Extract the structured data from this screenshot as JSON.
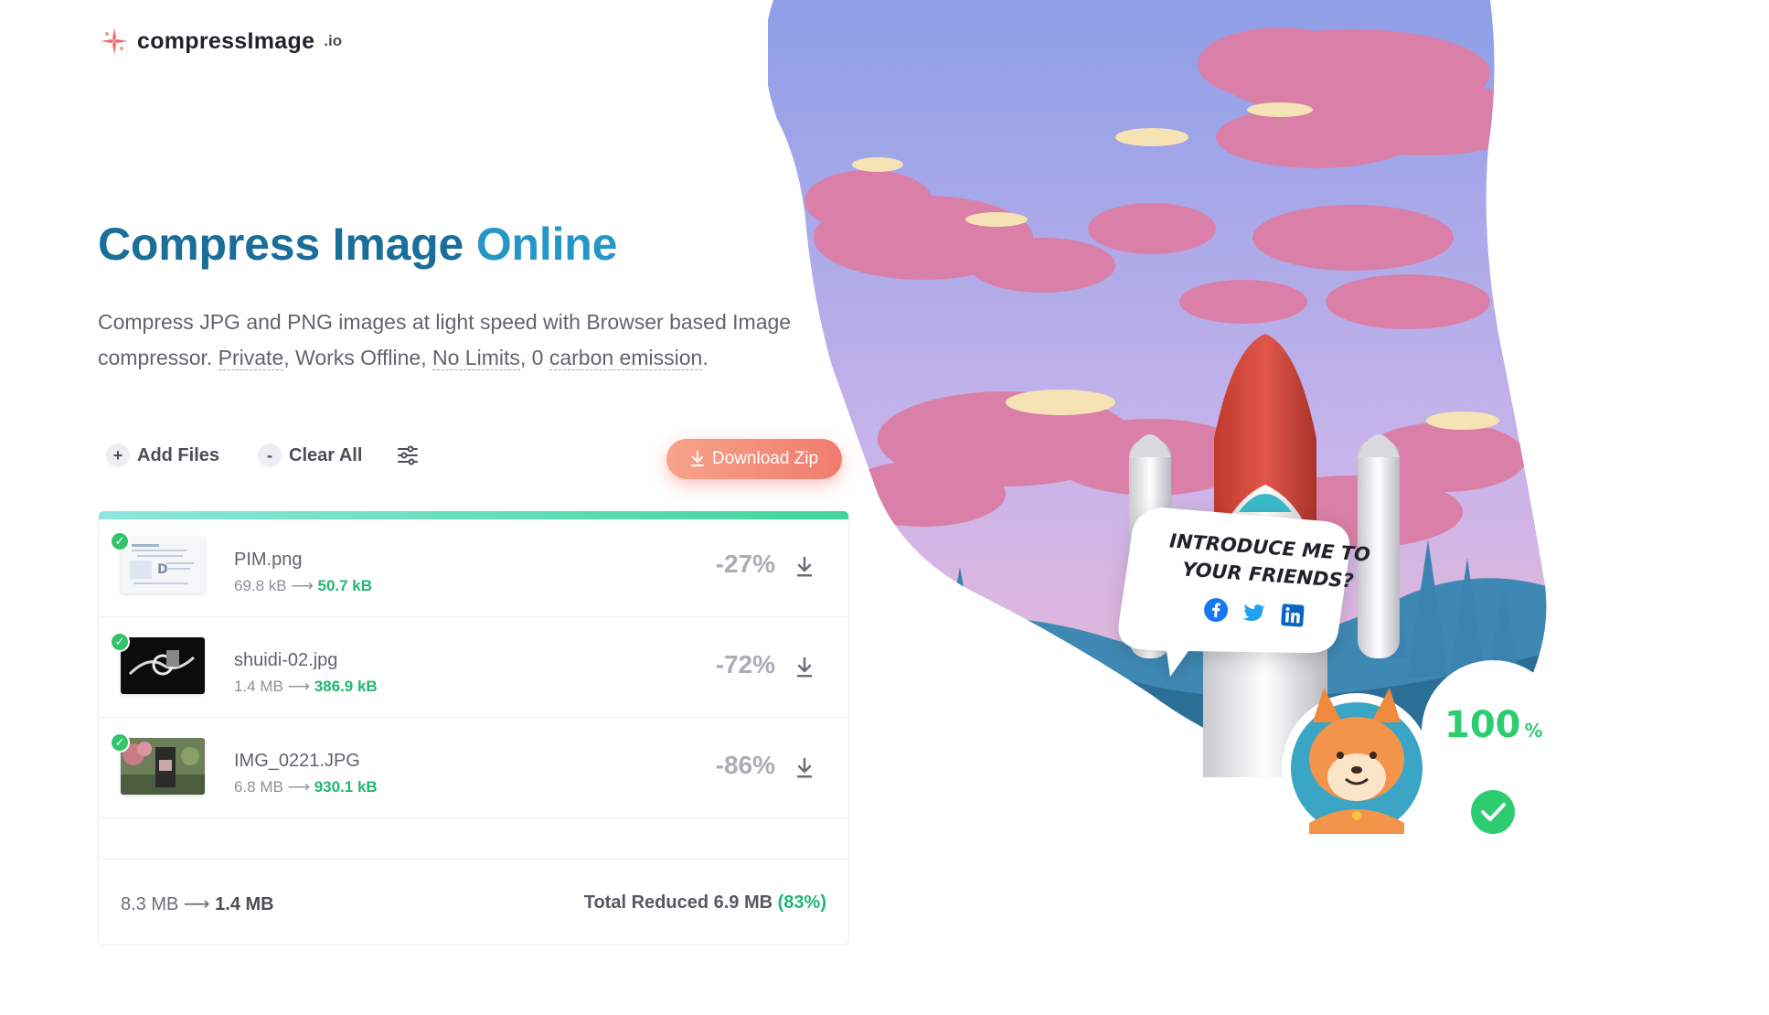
{
  "brand": {
    "name": "compressImage",
    "tld": ".io"
  },
  "hero": {
    "title_part1": "Compress Image",
    "title_part2": "Online",
    "desc_line1": "Compress JPG and PNG images at light speed with Browser based Image",
    "desc_line2_prefix": "compressor. ",
    "link_private": "Private",
    "sep1": ", Works Offline, ",
    "link_nolimits": "No Limits",
    "sep2": ", 0 ",
    "link_carbon": "carbon emission",
    "end": "."
  },
  "toolbar": {
    "add_files_symbol": "+",
    "add_files": "Add Files",
    "clear_all_symbol": "-",
    "clear_all": "Clear All",
    "download_zip": "Download Zip"
  },
  "progress": 1.0,
  "files": [
    {
      "name": "PIM.png",
      "original": "69.8 kB",
      "compressed": "50.7 kB",
      "reduction": "-27%",
      "status": "done"
    },
    {
      "name": "shuidi-02.jpg",
      "original": "1.4 MB",
      "compressed": "386.9 kB",
      "reduction": "-72%",
      "status": "done"
    },
    {
      "name": "IMG_0221.JPG",
      "original": "6.8 MB",
      "compressed": "930.1 kB",
      "reduction": "-86%",
      "status": "done"
    }
  ],
  "summary": {
    "total_original": "8.3 MB",
    "total_compressed": "1.4 MB",
    "reduced_label": "Total Reduced",
    "reduced_amount": "6.9 MB",
    "reduced_pct": "(83%)"
  },
  "share": {
    "prompt_line1": "INTRODUCE ME TO",
    "prompt_line2": "YOUR FRIENDS?",
    "icons": [
      "facebook-icon",
      "twitter-icon",
      "linkedin-icon"
    ]
  },
  "completion": {
    "value": "100",
    "unit": "%"
  },
  "colors": {
    "title": "#1a6f9a",
    "accent": "#2596c8",
    "download_btn": "#f07c6e",
    "success": "#22b573",
    "progress_start": "#8ee7df",
    "progress_end": "#3fd59a"
  }
}
